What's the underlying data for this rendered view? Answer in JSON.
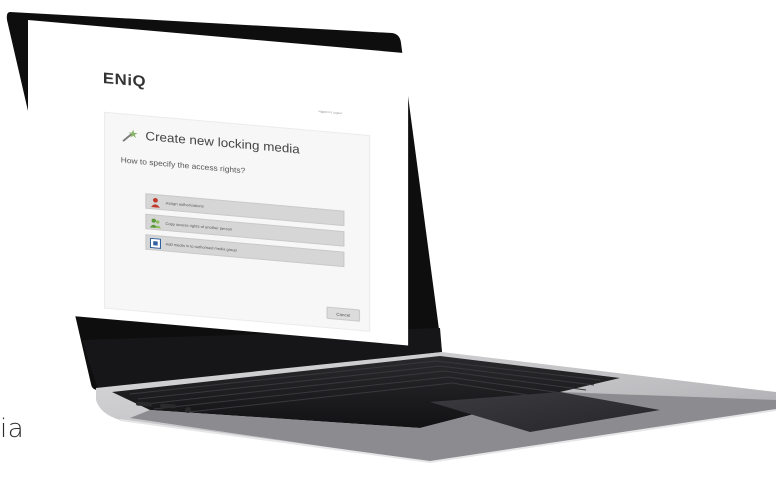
{
  "app": {
    "logo": "ENiQ",
    "user_info": "logged in | Logout"
  },
  "dialog": {
    "title": "Create new locking media",
    "question": "How to specify the access rights?",
    "options": [
      {
        "label": "Assign authorizations",
        "icon": "person-red-icon"
      },
      {
        "label": "Copy access rights of another person",
        "icon": "persons-green-icon"
      },
      {
        "label": "Add media in to authorised media group",
        "icon": "group-blue-icon"
      }
    ],
    "cancel_label": "Cancel"
  },
  "caption": {
    "text": "ia"
  },
  "colors": {
    "bezel": "#0e0e0e",
    "chassis": "#c9c9cb",
    "keyboard": "#1b1b1d",
    "option_bg": "#d6d6d6"
  }
}
